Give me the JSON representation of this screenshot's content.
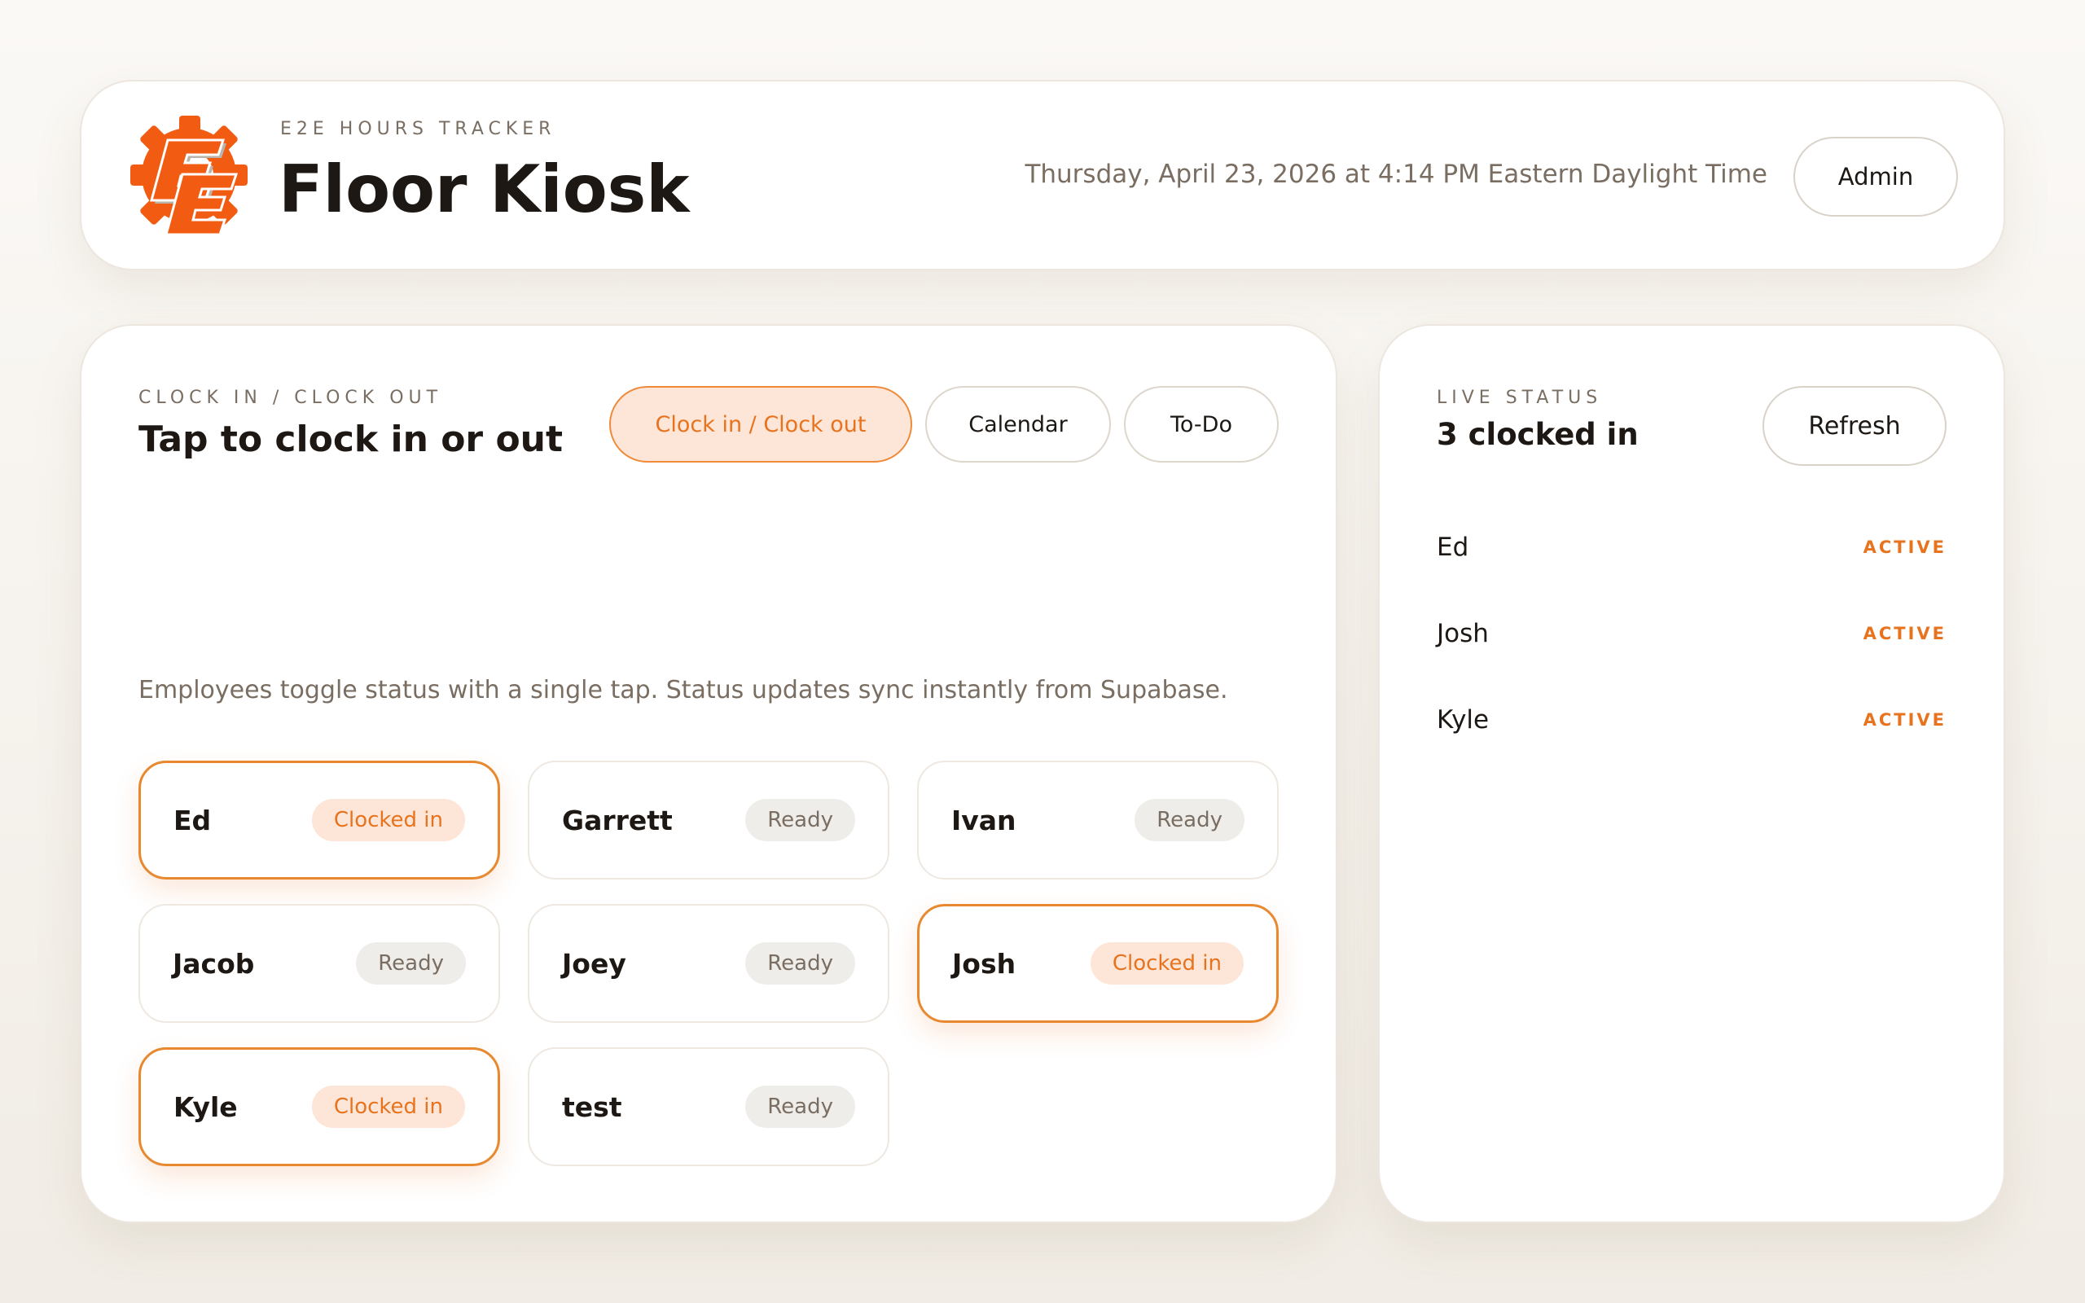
{
  "header": {
    "eyebrow": "E2E HOURS TRACKER",
    "title": "Floor Kiosk",
    "datetime": "Thursday, April 23, 2026 at 4:14 PM Eastern Daylight Time",
    "admin_label": "Admin",
    "logo_text": "E2E"
  },
  "main": {
    "eyebrow": "CLOCK IN / CLOCK OUT",
    "heading": "Tap to clock in or out",
    "tabs": [
      {
        "label": "Clock in / Clock out",
        "active": true
      },
      {
        "label": "Calendar",
        "active": false
      },
      {
        "label": "To-Do",
        "active": false
      }
    ],
    "description": "Employees toggle status with a single tap. Status updates sync instantly from Supabase.",
    "employees": [
      {
        "name": "Ed",
        "status": "Clocked in"
      },
      {
        "name": "Garrett",
        "status": "Ready"
      },
      {
        "name": "Ivan",
        "status": "Ready"
      },
      {
        "name": "Jacob",
        "status": "Ready"
      },
      {
        "name": "Joey",
        "status": "Ready"
      },
      {
        "name": "Josh",
        "status": "Clocked in"
      },
      {
        "name": "Kyle",
        "status": "Clocked in"
      },
      {
        "name": "test",
        "status": "Ready"
      }
    ]
  },
  "live": {
    "eyebrow": "LIVE STATUS",
    "count_label": "3 clocked in",
    "refresh_label": "Refresh",
    "rows": [
      {
        "name": "Ed",
        "status": "ACTIVE"
      },
      {
        "name": "Josh",
        "status": "ACTIVE"
      },
      {
        "name": "Kyle",
        "status": "ACTIVE"
      }
    ]
  },
  "colors": {
    "accent": "#e8731e",
    "accent_soft": "#fde6d7",
    "muted_text": "#7a6e62",
    "ready_badge": "#efedea",
    "logo_orange": "#f25c12"
  }
}
